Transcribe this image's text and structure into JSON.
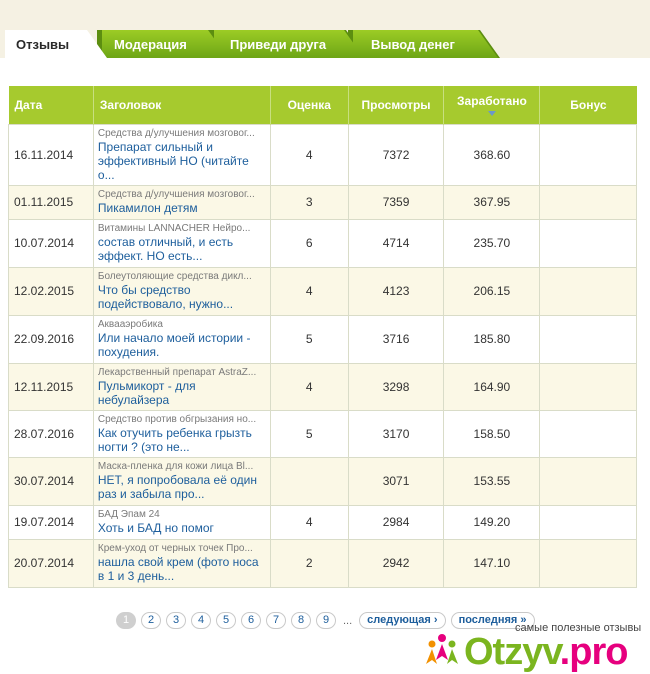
{
  "tabs": [
    {
      "label": "Отзывы",
      "active": true
    },
    {
      "label": "Модерация",
      "active": false
    },
    {
      "label": "Приведи друга",
      "active": false
    },
    {
      "label": "Вывод денег",
      "active": false
    }
  ],
  "table": {
    "headers": {
      "date": "Дата",
      "title": "Заголовок",
      "rating": "Оценка",
      "views": "Просмотры",
      "earned": "Заработано",
      "bonus": "Бонус"
    },
    "rows": [
      {
        "date": "16.11.2014",
        "category": "Средства д/улучшения мозговог...",
        "title": "Препарат сильный и эффективный НО (читайте о...",
        "rating": "4",
        "views": "7372",
        "earned": "368.60",
        "bonus": ""
      },
      {
        "date": "01.11.2015",
        "category": "Средства д/улучшения мозговог...",
        "title": "Пикамилон детям",
        "rating": "3",
        "views": "7359",
        "earned": "367.95",
        "bonus": ""
      },
      {
        "date": "10.07.2014",
        "category": "Витамины LANNACHER Нейро...",
        "title": "состав отличный, и есть эффект. НО есть...",
        "rating": "6",
        "views": "4714",
        "earned": "235.70",
        "bonus": ""
      },
      {
        "date": "12.02.2015",
        "category": "Болеутоляющие средства дикл...",
        "title": "Что бы средство подействовало, нужно...",
        "rating": "4",
        "views": "4123",
        "earned": "206.15",
        "bonus": ""
      },
      {
        "date": "22.09.2016",
        "category": "Аквааэробика",
        "title": "Или начало моей истории - похудения.",
        "rating": "5",
        "views": "3716",
        "earned": "185.80",
        "bonus": ""
      },
      {
        "date": "12.11.2015",
        "category": "Лекарственный препарат AstraZ...",
        "title": "Пульмикорт - для небулайзера",
        "rating": "4",
        "views": "3298",
        "earned": "164.90",
        "bonus": ""
      },
      {
        "date": "28.07.2016",
        "category": "Средство против обгрызания но...",
        "title": "Как отучить ребенка грызть ногти ? (это не...",
        "rating": "5",
        "views": "3170",
        "earned": "158.50",
        "bonus": ""
      },
      {
        "date": "30.07.2014",
        "category": "Маска-пленка для кожи лица Bl...",
        "title": "НЕТ, я попробовала её один раз и забыла про...",
        "rating": "",
        "views": "3071",
        "earned": "153.55",
        "bonus": ""
      },
      {
        "date": "19.07.2014",
        "category": "БАД Эпам 24",
        "title": "Хоть и БАД но помог",
        "rating": "4",
        "views": "2984",
        "earned": "149.20",
        "bonus": ""
      },
      {
        "date": "20.07.2014",
        "category": "Крем-уход от черных точек Про...",
        "title": "нашла свой крем (фото носа в 1 и 3 день...",
        "rating": "2",
        "views": "2942",
        "earned": "147.10",
        "bonus": ""
      }
    ]
  },
  "pagination": {
    "pages": [
      "1",
      "2",
      "3",
      "4",
      "5",
      "6",
      "7",
      "8",
      "9"
    ],
    "current": "1",
    "ellipsis": "...",
    "next": "следующая ›",
    "last": "последняя »"
  },
  "watermark": {
    "tagline": "самые полезные отзывы",
    "logo_main": "Otzyv",
    "logo_suffix": ".pro"
  },
  "colors": {
    "tab_green": "#8cbf1f",
    "header_green": "#a6ca2e",
    "link_blue": "#1d5e9c",
    "row_alt": "#fbf8e6",
    "logo_green": "#7bb51f",
    "logo_pink": "#e6007e"
  }
}
